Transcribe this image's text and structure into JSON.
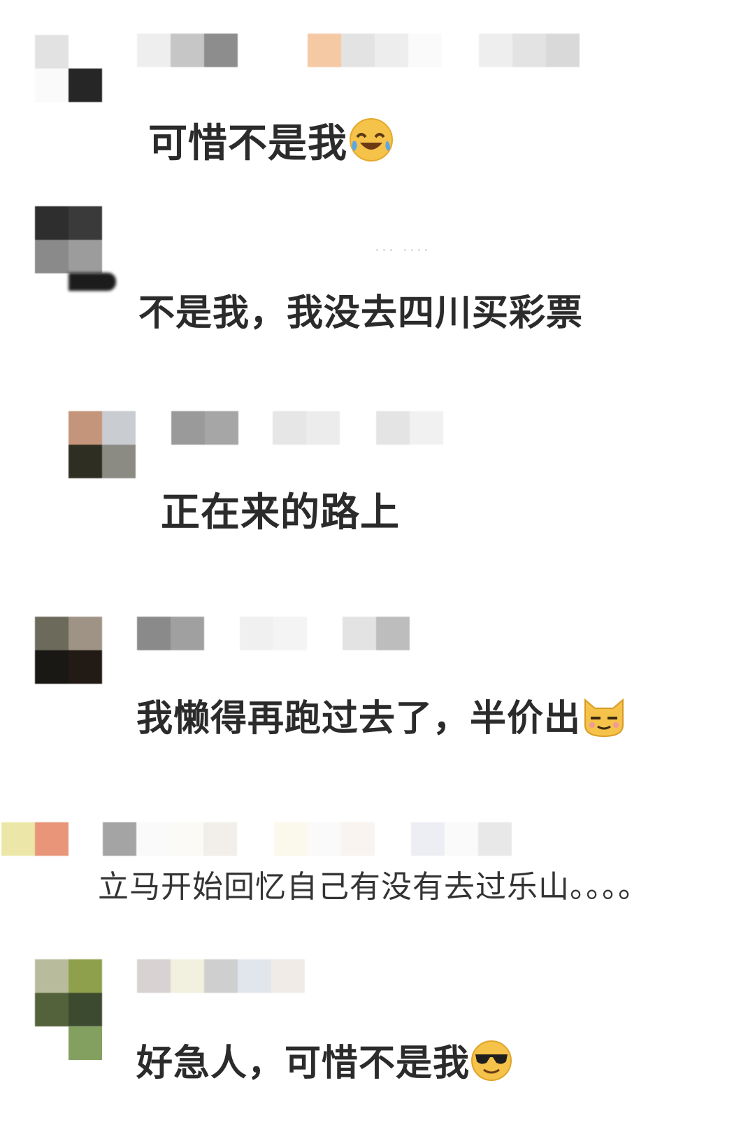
{
  "comments": [
    {
      "text": "可惜不是我",
      "emoji": "laughing-crying-emoji"
    },
    {
      "text": "不是我，我没去四川买彩票",
      "meta": "...    ...."
    },
    {
      "text": "正在来的路上"
    },
    {
      "text": "我懒得再跑过去了，半价出",
      "emoji": "cat-smirk-emoji"
    },
    {
      "text": "立马开始回忆自己有没有去过乐山。。。。"
    },
    {
      "text": "好急人，可惜不是我",
      "emoji": "sunglasses-emoji"
    }
  ],
  "colors": {
    "background": "#ffffff",
    "text": "#2b2b2b",
    "emoji_yellow": "#f5c24a"
  }
}
